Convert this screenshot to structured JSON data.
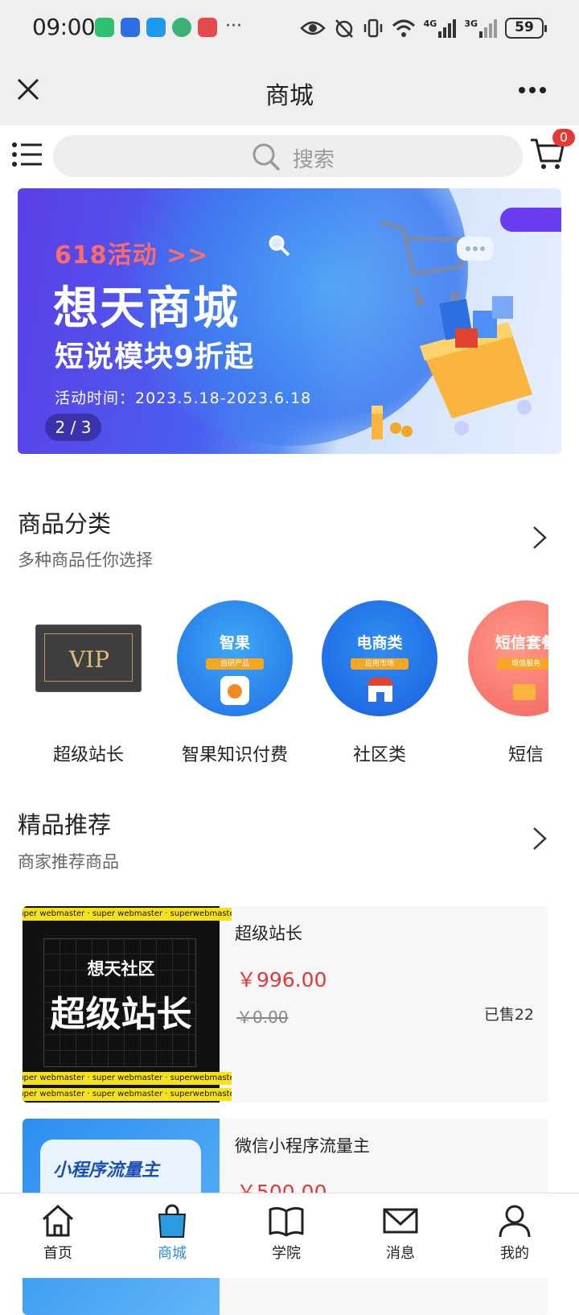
{
  "status_bar": {
    "time": "09:00",
    "battery": "59",
    "network_labels": [
      "4G",
      "3G"
    ]
  },
  "nav": {
    "title": "商城"
  },
  "search": {
    "placeholder": "搜索",
    "cart_count": "0"
  },
  "banner": {
    "tag": "618活动 >>",
    "title": "想天商城",
    "subtitle": "短说模块9折起",
    "date": "活动时间：2023.5.18-2023.6.18",
    "pager": "2 / 3"
  },
  "categories_section": {
    "title": "商品分类",
    "subtitle": "多种商品任你选择",
    "items": [
      {
        "label": "超级站长",
        "badge": "VIP"
      },
      {
        "label": "智果知识付费",
        "badge": "智果",
        "chip": "自研产品"
      },
      {
        "label": "社区类",
        "badge": "电商类",
        "chip": "应用市场"
      },
      {
        "label": "短信",
        "badge": "短信套餐",
        "chip": "增值服务"
      }
    ]
  },
  "featured_section": {
    "title": "精品推荐",
    "subtitle": "商家推荐商品",
    "products": [
      {
        "name": "超级站长",
        "price": "￥996.00",
        "original_price": "￥0.00",
        "sold": "已售22",
        "image_title": "想天社区",
        "image_headline": "超级站长",
        "image_ribbon": "super webmaster · super webmaster · superwebmaster"
      },
      {
        "name": "微信小程序流量主",
        "price": "￥500.00",
        "image_headline": "小程序流量主"
      }
    ]
  },
  "tabbar": {
    "items": [
      {
        "label": "首页"
      },
      {
        "label": "商城"
      },
      {
        "label": "学院"
      },
      {
        "label": "消息"
      },
      {
        "label": "我的"
      }
    ]
  },
  "colors": {
    "accent_blue": "#2a8fd8",
    "price_red": "#e53935",
    "header_gray": "#efefef"
  }
}
